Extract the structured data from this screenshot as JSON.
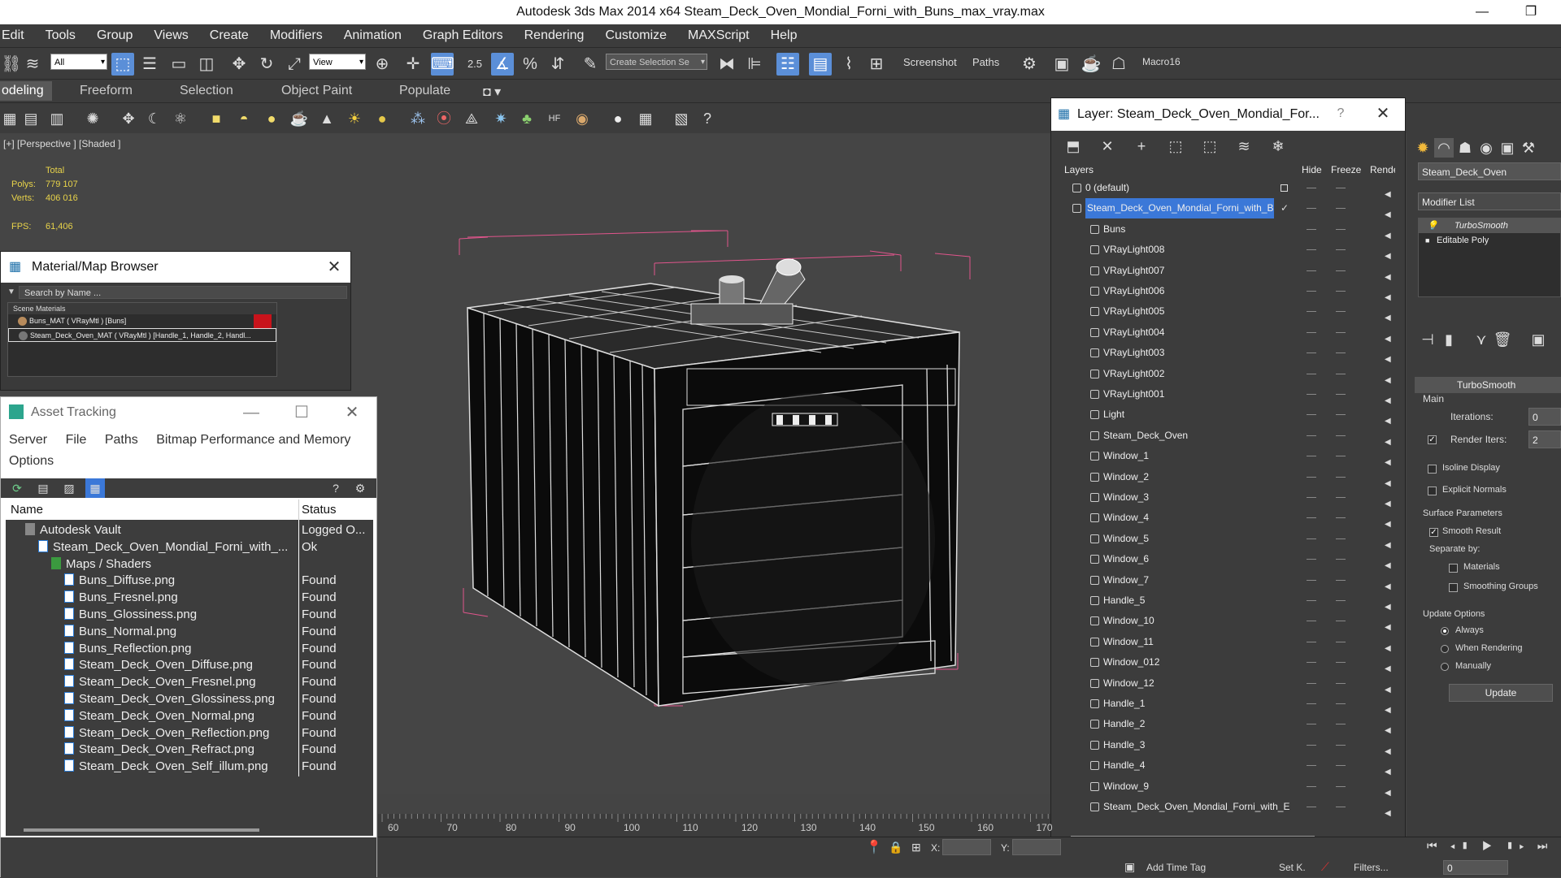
{
  "window": {
    "title": "Autodesk 3ds Max  2014 x64      Steam_Deck_Oven_Mondial_Forni_with_Buns_max_vray.max"
  },
  "menu": [
    "Edit",
    "Tools",
    "Group",
    "Views",
    "Create",
    "Modifiers",
    "Animation",
    "Graph Editors",
    "Rendering",
    "Customize",
    "MAXScript",
    "Help"
  ],
  "toolbar": {
    "filter": "All",
    "ref_coord": "View",
    "selection_set": "Create Selection Se",
    "snap_value": "2.5",
    "labels": [
      "Screenshot",
      "Paths",
      "Macro16"
    ]
  },
  "ribbon_tabs": [
    "odeling",
    "Freeform",
    "Selection",
    "Object Paint",
    "Populate"
  ],
  "viewport": {
    "label": "[+] [Perspective ] [Shaded ]",
    "stats": {
      "total_label": "Total",
      "polys_label": "Polys:",
      "polys": "779 107",
      "verts_label": "Verts:",
      "verts": "406 016",
      "fps_label": "FPS:",
      "fps": "61,406"
    }
  },
  "material_browser": {
    "title": "Material/Map Browser",
    "search_placeholder": "Search by Name ...",
    "section": "Scene Materials",
    "items": [
      "Buns_MAT  ( VRayMtl )  [Buns]",
      "Steam_Deck_Oven_MAT  ( VRayMtl )  [Handle_1, Handle_2, Handl..."
    ]
  },
  "asset_tracking": {
    "title": "Asset Tracking",
    "menu_row1": [
      "Server",
      "File",
      "Paths",
      "Bitmap Performance and Memory"
    ],
    "menu_row2": [
      "Options"
    ],
    "col_name": "Name",
    "col_status": "Status",
    "rows": [
      {
        "name": "Autodesk Vault",
        "status": "Logged O..."
      },
      {
        "name": "Steam_Deck_Oven_Mondial_Forni_with_...",
        "status": "Ok"
      },
      {
        "name": "Maps / Shaders",
        "status": ""
      },
      {
        "name": "Buns_Diffuse.png",
        "status": "Found"
      },
      {
        "name": "Buns_Fresnel.png",
        "status": "Found"
      },
      {
        "name": "Buns_Glossiness.png",
        "status": "Found"
      },
      {
        "name": "Buns_Normal.png",
        "status": "Found"
      },
      {
        "name": "Buns_Reflection.png",
        "status": "Found"
      },
      {
        "name": "Steam_Deck_Oven_Diffuse.png",
        "status": "Found"
      },
      {
        "name": "Steam_Deck_Oven_Fresnel.png",
        "status": "Found"
      },
      {
        "name": "Steam_Deck_Oven_Glossiness.png",
        "status": "Found"
      },
      {
        "name": "Steam_Deck_Oven_Normal.png",
        "status": "Found"
      },
      {
        "name": "Steam_Deck_Oven_Reflection.png",
        "status": "Found"
      },
      {
        "name": "Steam_Deck_Oven_Refract.png",
        "status": "Found"
      },
      {
        "name": "Steam_Deck_Oven_Self_illum.png",
        "status": "Found"
      }
    ]
  },
  "layer_manager": {
    "title": "Layer: Steam_Deck_Oven_Mondial_For...",
    "help": "?",
    "columns": [
      "Layers",
      "Hide",
      "Freeze",
      "Rende"
    ],
    "layers": [
      "0 (default)",
      "Steam_Deck_Oven_Mondial_Forni_with_Bun",
      "Buns",
      "VRayLight008",
      "VRayLight007",
      "VRayLight006",
      "VRayLight005",
      "VRayLight004",
      "VRayLight003",
      "VRayLight002",
      "VRayLight001",
      "Light",
      "Steam_Deck_Oven",
      "Window_1",
      "Window_2",
      "Window_3",
      "Window_4",
      "Window_5",
      "Window_6",
      "Window_7",
      "Handle_5",
      "Window_10",
      "Window_11",
      "Window_012",
      "Window_12",
      "Handle_1",
      "Handle_2",
      "Handle_3",
      "Handle_4",
      "Window_9",
      "Steam_Deck_Oven_Mondial_Forni_with_E"
    ]
  },
  "command_panel": {
    "object_name": "Steam_Deck_Oven",
    "modifier_list": "Modifier List",
    "stack": [
      "TurboSmooth",
      "Editable Poly"
    ],
    "rollout_title": "TurboSmooth",
    "main_group": "Main",
    "iterations_label": "Iterations:",
    "iterations": "0",
    "render_iters_label": "Render Iters:",
    "render_iters": "2",
    "isoline": "Isoline Display",
    "explicit_normals": "Explicit Normals",
    "surface_group": "Surface Parameters",
    "smooth_result": "Smooth Result",
    "separate_by": "Separate by:",
    "materials": "Materials",
    "smoothing_groups": "Smoothing Groups",
    "update_group": "Update Options",
    "always": "Always",
    "when_rendering": "When Rendering",
    "manually": "Manually",
    "update_button": "Update"
  },
  "timeline": {
    "ticks": [
      "60",
      "70",
      "80",
      "90",
      "100",
      "110",
      "120",
      "130",
      "140",
      "150",
      "160",
      "170"
    ]
  },
  "statusbar": {
    "x_label": "X:",
    "y_label": "Y:",
    "add_time_tag": "Add Time Tag",
    "set_k": "Set K.",
    "filters": "Filters...",
    "frame": "0"
  },
  "colors": {
    "selection_blue": "#3b78d8",
    "stat_yellow": "#e8d34a",
    "bbox_pink": "#e0558c"
  }
}
